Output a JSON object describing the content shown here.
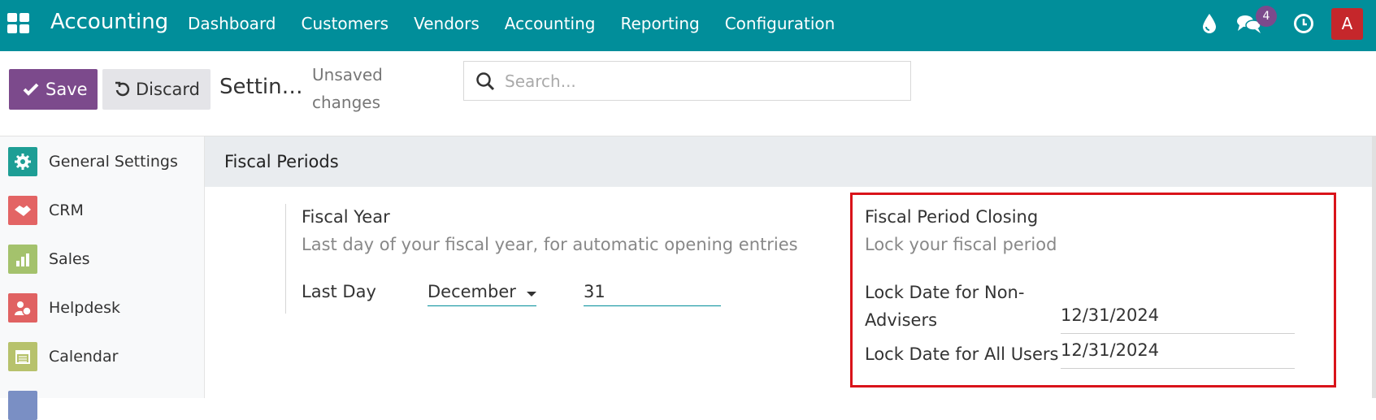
{
  "navbar": {
    "brand": "Accounting",
    "menu": [
      "Dashboard",
      "Customers",
      "Vendors",
      "Accounting",
      "Reporting",
      "Configuration"
    ],
    "chat_badge": "4",
    "avatar_letter": "A",
    "color": "#018e9a"
  },
  "control_panel": {
    "save_label": "Save",
    "discard_label": "Discard",
    "breadcrumb": "Settin…",
    "unsaved": "Unsaved changes",
    "search_placeholder": "Search..."
  },
  "sidebar": {
    "items": [
      {
        "label": "General Settings",
        "icon": "gear-icon",
        "color": "#1e9e95"
      },
      {
        "label": "CRM",
        "icon": "handshake-icon",
        "color": "#e36464"
      },
      {
        "label": "Sales",
        "icon": "chart-icon",
        "color": "#a4c26c"
      },
      {
        "label": "Helpdesk",
        "icon": "support-icon",
        "color": "#e06262"
      },
      {
        "label": "Calendar",
        "icon": "calendar-icon",
        "color": "#b7c26c"
      }
    ]
  },
  "section": {
    "title": "Fiscal Periods"
  },
  "fiscal_year": {
    "title": "Fiscal Year",
    "description": "Last day of your fiscal year, for automatic opening entries",
    "last_day_label": "Last Day",
    "month": "December",
    "day": "31"
  },
  "fiscal_closing": {
    "title": "Fiscal Period Closing",
    "description": "Lock your fiscal period",
    "non_advisers_label": "Lock Date for Non-Advisers",
    "non_advisers_value": "12/31/2024",
    "all_users_label": "Lock Date for All Users",
    "all_users_value": "12/31/2024"
  },
  "colors": {
    "primary": "#7c4a8c",
    "highlight": "#d9131a"
  }
}
